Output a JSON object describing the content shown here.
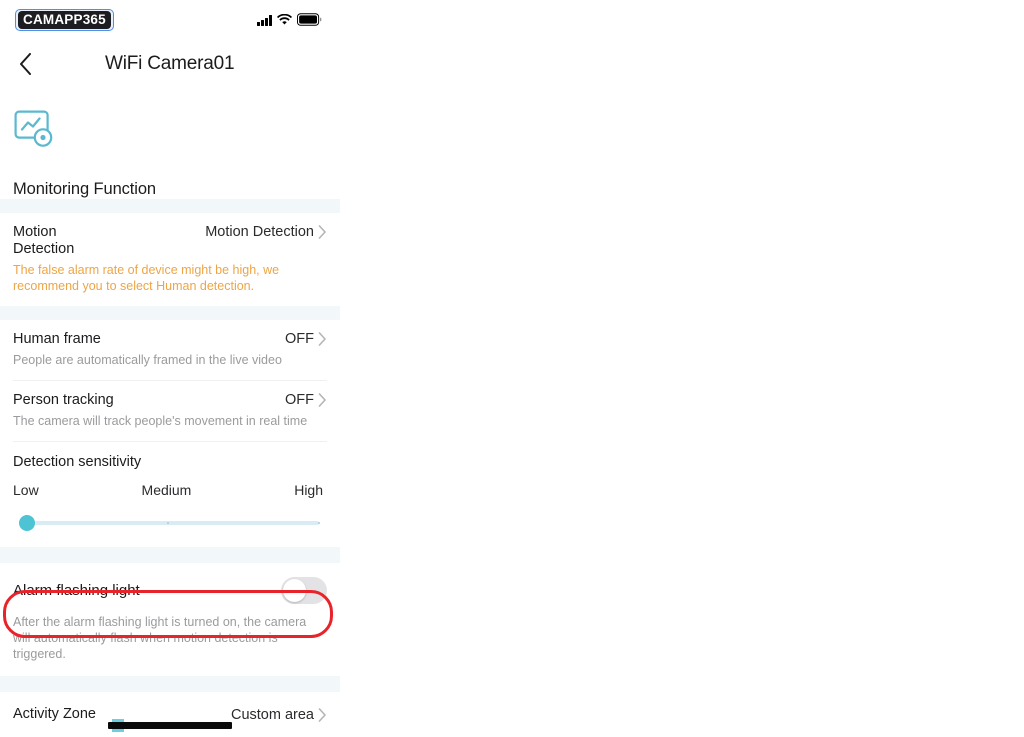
{
  "statusbar": {
    "logo": "CAMAPP365",
    "signal_icon": "cellular-signal-icon",
    "wifi_icon": "wifi-icon",
    "battery_icon": "battery-icon"
  },
  "navbar": {
    "back_icon": "back-chevron-icon",
    "title": "WiFi Camera01"
  },
  "header": {
    "icon": "monitoring-chart-eye-icon",
    "title": "Monitoring Function"
  },
  "rows": {
    "motion_detection": {
      "label": "Motion\nDetection",
      "label_line1": "Motion",
      "label_line2": "Detection",
      "value": "Motion Detection",
      "chevron": "chevron-right-icon",
      "warning": "The false alarm rate of device might be high, we recommend you to select Human detection."
    },
    "human_frame": {
      "label": "Human frame",
      "value": "OFF",
      "chevron": "chevron-right-icon",
      "description": "People are automatically framed in the live video"
    },
    "person_tracking": {
      "label": "Person tracking",
      "value": "OFF",
      "chevron": "chevron-right-icon",
      "description": "The camera will track people's movement in real time"
    }
  },
  "sensitivity": {
    "title": "Detection sensitivity",
    "labels": {
      "low": "Low",
      "medium": "Medium",
      "high": "High"
    },
    "value": "Low",
    "thumb_position_percent": 0
  },
  "alarm_flashing_light": {
    "label": "Alarm flashing light",
    "toggle_state": "off",
    "toggle_name": "alarm-flashing-light-toggle",
    "description": "After the alarm flashing light is turned on, the camera will automatically flash when motion detection is triggered."
  },
  "activity_zone": {
    "label": "Activity Zone",
    "value": "Custom area",
    "chevron": "chevron-right-icon"
  },
  "annotation": {
    "type": "red-highlight-box",
    "color": "#e8232a",
    "target": "alarm-flashing-light-row"
  },
  "colors": {
    "accent_teal": "#4ec3d4",
    "warning_orange": "#eda545",
    "annotation_red": "#e8232a",
    "section_gap": "#f2f7fa",
    "text_primary": "#1c1c1e",
    "text_secondary": "#9b9b9e"
  }
}
